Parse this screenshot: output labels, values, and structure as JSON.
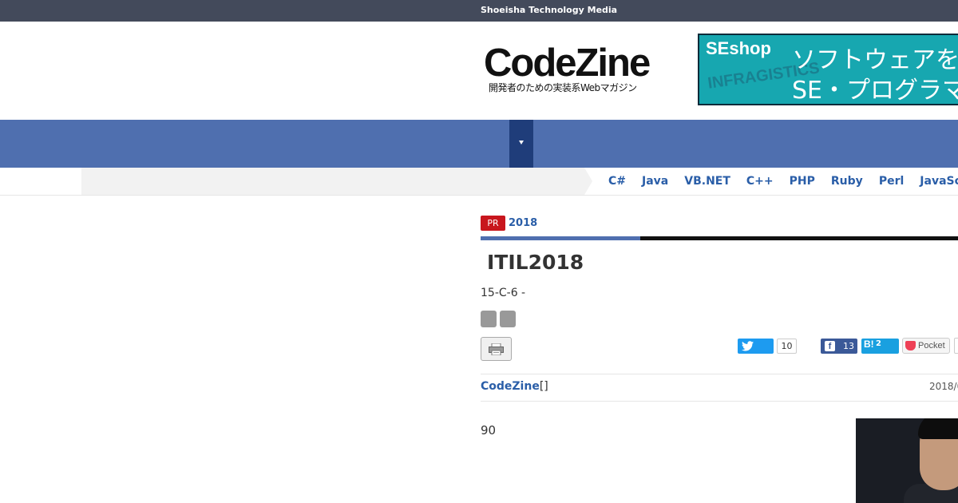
{
  "topbar": {
    "site_network": "Shoeisha Technology Media"
  },
  "header": {
    "logo": {
      "name": "CodeZine",
      "tagline": "開発者のための実装系Webマガジン"
    },
    "banner": {
      "brand": "SEshop",
      "line1": "ソフトウェアを",
      "line2": "SE・プログラマ",
      "watermark": "INFRAGISTICS"
    }
  },
  "languages": [
    "C#",
    "Java",
    "VB.NET",
    "C++",
    "PHP",
    "Ruby",
    "Perl",
    "JavaSc"
  ],
  "article": {
    "badge": "PR",
    "year_link": "2018",
    "title": "ITIL2018",
    "subtitle": "15-C-6 -",
    "author": "CodeZine",
    "author_suffix": "[]",
    "date": "2018/0",
    "body": "90"
  },
  "social": {
    "twitter_count": "10",
    "facebook_count": "13",
    "hatena_label": "B!",
    "hatena_count": "2",
    "pocket_label": "Pocket"
  },
  "colors": {
    "topbar": "#434a5b",
    "nav": "#4f6faf",
    "accent_link": "#2a5ea8",
    "pr_badge": "#c8161d"
  }
}
